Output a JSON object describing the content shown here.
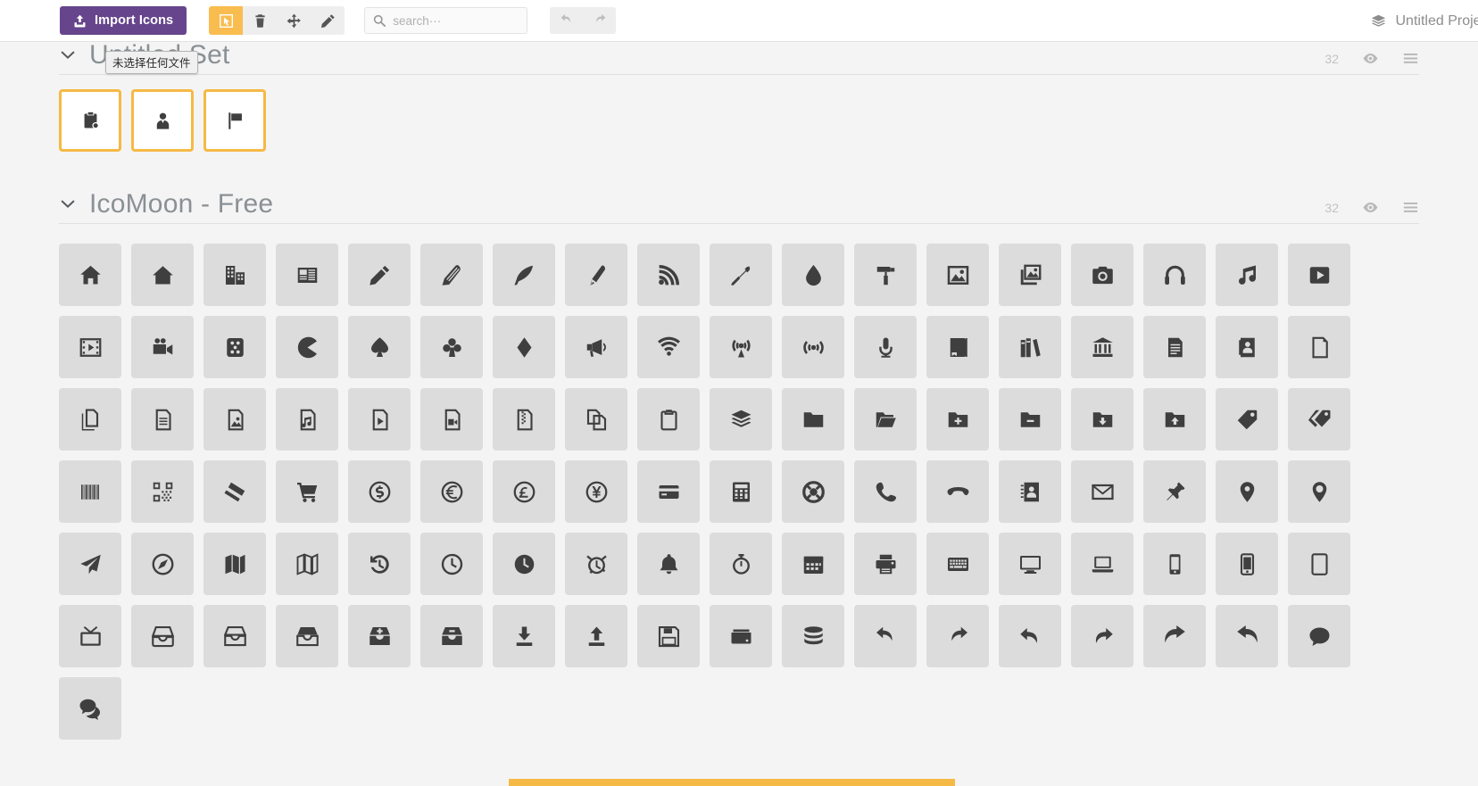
{
  "toolbar": {
    "import_label": "Import Icons",
    "import_icon": "upload-icon",
    "tools": [
      {
        "name": "select-tool",
        "icon": "cursor-select-icon",
        "active": true
      },
      {
        "name": "delete-tool",
        "icon": "trash-icon",
        "active": false
      },
      {
        "name": "move-tool",
        "icon": "move-arrows-icon",
        "active": false
      },
      {
        "name": "edit-tool",
        "icon": "pencil-icon",
        "active": false
      }
    ],
    "search": {
      "placeholder": "search···",
      "value": "",
      "icon": "search-icon"
    },
    "history": [
      {
        "name": "undo-button",
        "icon": "undo-arrow-icon"
      },
      {
        "name": "redo-button",
        "icon": "redo-arrow-icon"
      }
    ],
    "project": {
      "icon": "layers-icon",
      "name": "Untitled Project"
    }
  },
  "tooltip": {
    "text": "未选择任何文件"
  },
  "sets": [
    {
      "title": "Untitled Set",
      "count": "32",
      "collapse_icon": "chevron-down-icon",
      "eye_icon": "eye-icon",
      "menu_icon": "hamburger-menu-icon",
      "selected": true,
      "icons": [
        {
          "name": "clipboard-icon"
        },
        {
          "name": "user-tie-icon"
        },
        {
          "name": "flag-icon"
        }
      ]
    },
    {
      "title": "IcoMoon - Free",
      "count": "32",
      "collapse_icon": "chevron-down-icon",
      "eye_icon": "eye-icon",
      "menu_icon": "hamburger-menu-icon",
      "selected": false,
      "icons": [
        {
          "name": "home-icon"
        },
        {
          "name": "home2-icon"
        },
        {
          "name": "office-icon"
        },
        {
          "name": "newspaper-icon"
        },
        {
          "name": "pencil-icon"
        },
        {
          "name": "pencil2-icon"
        },
        {
          "name": "quill-icon"
        },
        {
          "name": "pen-icon"
        },
        {
          "name": "blog-icon"
        },
        {
          "name": "eyedropper-icon"
        },
        {
          "name": "droplet-icon"
        },
        {
          "name": "paint-format-icon"
        },
        {
          "name": "image-icon"
        },
        {
          "name": "images-icon"
        },
        {
          "name": "camera-icon"
        },
        {
          "name": "headphones-icon"
        },
        {
          "name": "music-icon"
        },
        {
          "name": "play-icon"
        },
        {
          "name": "film-icon"
        },
        {
          "name": "video-camera-icon"
        },
        {
          "name": "dice-icon"
        },
        {
          "name": "pacman-icon"
        },
        {
          "name": "spades-icon"
        },
        {
          "name": "clubs-icon"
        },
        {
          "name": "diamonds-icon"
        },
        {
          "name": "bullhorn-icon"
        },
        {
          "name": "connection-icon"
        },
        {
          "name": "podcast-icon"
        },
        {
          "name": "feed-icon"
        },
        {
          "name": "mic-icon"
        },
        {
          "name": "book-icon"
        },
        {
          "name": "books-icon"
        },
        {
          "name": "library-icon"
        },
        {
          "name": "file-text-icon"
        },
        {
          "name": "profile-icon"
        },
        {
          "name": "file-empty-icon"
        },
        {
          "name": "files-empty-icon"
        },
        {
          "name": "file-text2-icon"
        },
        {
          "name": "file-picture-icon"
        },
        {
          "name": "file-music-icon"
        },
        {
          "name": "file-play-icon"
        },
        {
          "name": "file-video-icon"
        },
        {
          "name": "file-zip-icon"
        },
        {
          "name": "copy-icon"
        },
        {
          "name": "paste-icon"
        },
        {
          "name": "stack-icon"
        },
        {
          "name": "folder-icon"
        },
        {
          "name": "folder-open-icon"
        },
        {
          "name": "folder-plus-icon"
        },
        {
          "name": "folder-minus-icon"
        },
        {
          "name": "folder-download-icon"
        },
        {
          "name": "folder-upload-icon"
        },
        {
          "name": "price-tag-icon"
        },
        {
          "name": "price-tags-icon"
        },
        {
          "name": "barcode-icon"
        },
        {
          "name": "qrcode-icon"
        },
        {
          "name": "ticket-icon"
        },
        {
          "name": "cart-icon"
        },
        {
          "name": "coin-dollar-icon"
        },
        {
          "name": "coin-euro-icon"
        },
        {
          "name": "coin-pound-icon"
        },
        {
          "name": "coin-yen-icon"
        },
        {
          "name": "credit-card-icon"
        },
        {
          "name": "calculator-icon"
        },
        {
          "name": "lifebuoy-icon"
        },
        {
          "name": "phone-icon"
        },
        {
          "name": "phone-hang-up-icon"
        },
        {
          "name": "address-book-icon"
        },
        {
          "name": "envelop-icon"
        },
        {
          "name": "pushpin-icon"
        },
        {
          "name": "location-icon"
        },
        {
          "name": "location2-icon"
        },
        {
          "name": "paper-plane-icon"
        },
        {
          "name": "compass-icon"
        },
        {
          "name": "map-icon"
        },
        {
          "name": "map2-icon"
        },
        {
          "name": "history-icon"
        },
        {
          "name": "clock-icon"
        },
        {
          "name": "clock2-icon"
        },
        {
          "name": "alarm-icon"
        },
        {
          "name": "bell-icon"
        },
        {
          "name": "stopwatch-icon"
        },
        {
          "name": "calendar-icon"
        },
        {
          "name": "printer-icon"
        },
        {
          "name": "keyboard-icon"
        },
        {
          "name": "display-icon"
        },
        {
          "name": "laptop-icon"
        },
        {
          "name": "mobile-icon"
        },
        {
          "name": "mobile2-icon"
        },
        {
          "name": "tablet-icon"
        },
        {
          "name": "tv-icon"
        },
        {
          "name": "drawer-icon"
        },
        {
          "name": "drawer2-icon"
        },
        {
          "name": "drawer3-icon"
        },
        {
          "name": "box-add-icon"
        },
        {
          "name": "box-remove-icon"
        },
        {
          "name": "download-icon"
        },
        {
          "name": "upload-icon"
        },
        {
          "name": "floppy-disk-icon"
        },
        {
          "name": "drive-icon"
        },
        {
          "name": "database-icon"
        },
        {
          "name": "undo-icon"
        },
        {
          "name": "redo-icon"
        },
        {
          "name": "undo2-icon"
        },
        {
          "name": "redo2-icon"
        },
        {
          "name": "forward-icon"
        },
        {
          "name": "reply-icon"
        },
        {
          "name": "bubble-icon"
        },
        {
          "name": "bubbles-icon"
        }
      ]
    }
  ],
  "bottom_bar": {
    "name": "selection-progress-bar",
    "color": "#f5b945"
  }
}
